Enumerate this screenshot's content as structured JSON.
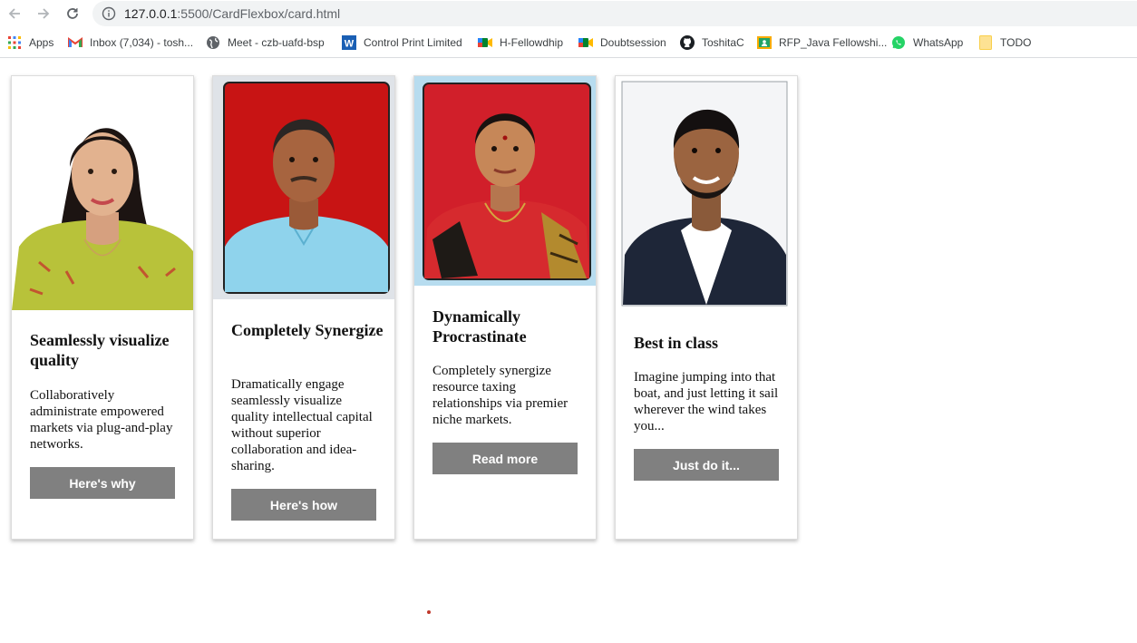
{
  "browser": {
    "url_host": "127.0.0.1",
    "url_path": ":5500/CardFlexbox/card.html",
    "bookmarks": [
      {
        "label": "Apps",
        "icon": "apps-grid-icon"
      },
      {
        "label": "Inbox (7,034) - tosh...",
        "icon": "gmail-icon"
      },
      {
        "label": "Meet - czb-uafd-bsp",
        "icon": "globe-icon"
      },
      {
        "label": "Control Print Limited",
        "icon": "w-logo-icon"
      },
      {
        "label": "H-Fellowdhip",
        "icon": "meet-camera-icon"
      },
      {
        "label": "Doubtsession",
        "icon": "meet-camera-icon"
      },
      {
        "label": "ToshitaC",
        "icon": "github-icon"
      },
      {
        "label": "RFP_Java Fellowshi...",
        "icon": "classroom-icon"
      },
      {
        "label": "WhatsApp",
        "icon": "whatsapp-icon"
      },
      {
        "label": "TODO",
        "icon": "note-icon"
      }
    ]
  },
  "cards": [
    {
      "title": "Seamlessly visualize quality",
      "text": "Collaboratively administrate empowered markets via plug-and-play networks.",
      "button": "Here's why"
    },
    {
      "title": "Completely Synergize",
      "text": "Dramatically engage seamlessly visualize quality intellectual capital without superior collaboration and idea-sharing.",
      "button": "Here's how"
    },
    {
      "title": "Dynamically Procrastinate",
      "text": "Completely synergize resource taxing relationships via premier niche markets.",
      "button": "Read more"
    },
    {
      "title": "Best in class",
      "text": "Imagine jumping into that boat, and just letting it sail wherever the wind takes you...",
      "button": "Just do it..."
    }
  ],
  "colors": {
    "button_bg": "#808080",
    "photo_red_bg": "#c81414",
    "photo_lightblue_bg": "#b7dcef"
  }
}
